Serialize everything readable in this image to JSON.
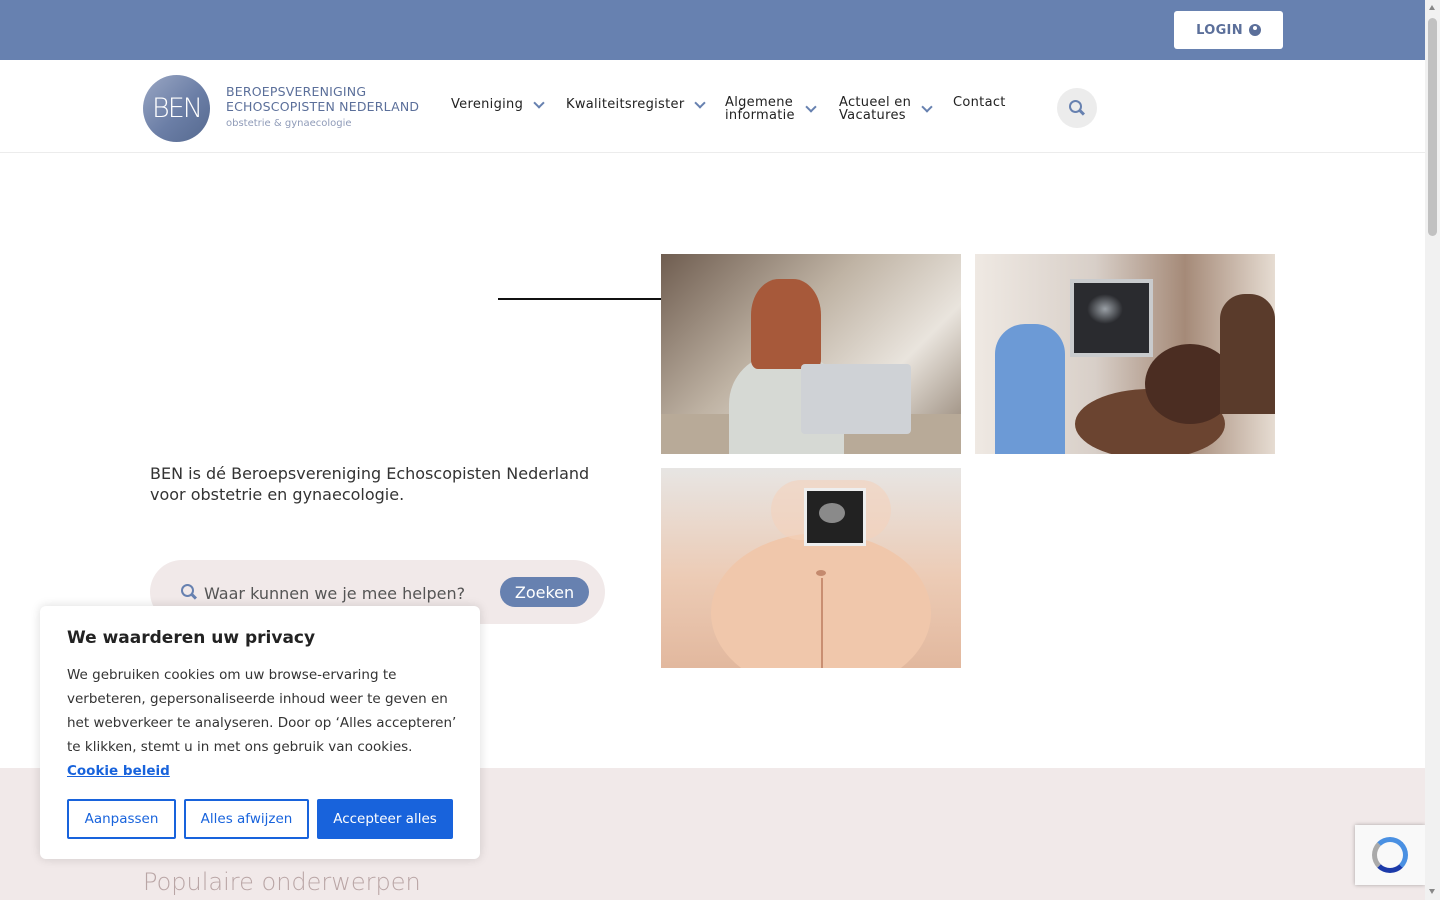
{
  "topbar": {
    "login_label": "LOGIN"
  },
  "logo": {
    "initials": "BEN",
    "line1": "BEROEPSVERENIGING",
    "line2": "ECHOSCOPISTEN NEDERLAND",
    "line3": "obstetrie & gynaecologie"
  },
  "nav": {
    "items": [
      {
        "label": "Vereniging",
        "dropdown": true
      },
      {
        "label": "Kwaliteitsregister",
        "dropdown": true
      },
      {
        "label": "Algemene\ninformatie",
        "dropdown": true
      },
      {
        "label": "Actueel en\nVacatures",
        "dropdown": true
      },
      {
        "label": "Contact",
        "dropdown": false
      }
    ]
  },
  "hero": {
    "tagline": "BEN is dé Beroepsvereniging Echoscopisten Nederland voor obstetrie en gynaecologie.",
    "search_placeholder": "Waar kunnen we je mee helpen?",
    "search_button": "Zoeken"
  },
  "section": {
    "populair_title": "Populaire onderwerpen"
  },
  "cookie": {
    "title": "We waarderen uw privacy",
    "text": "We gebruiken cookies om uw browse-ervaring te verbeteren, gepersonaliseerde inhoud weer te geven en het webverkeer te analyseren. Door op ‘Alles accepteren’ te klikken, stemt u in met ons gebruik van cookies.",
    "link": "Cookie beleid",
    "btn_customize": "Aanpassen",
    "btn_reject": "Alles afwijzen",
    "btn_accept": "Accepteer alles"
  },
  "colors": {
    "brand": "#6781b0",
    "pink_bg": "#f1e9e9",
    "cookie_blue": "#1863dc"
  }
}
